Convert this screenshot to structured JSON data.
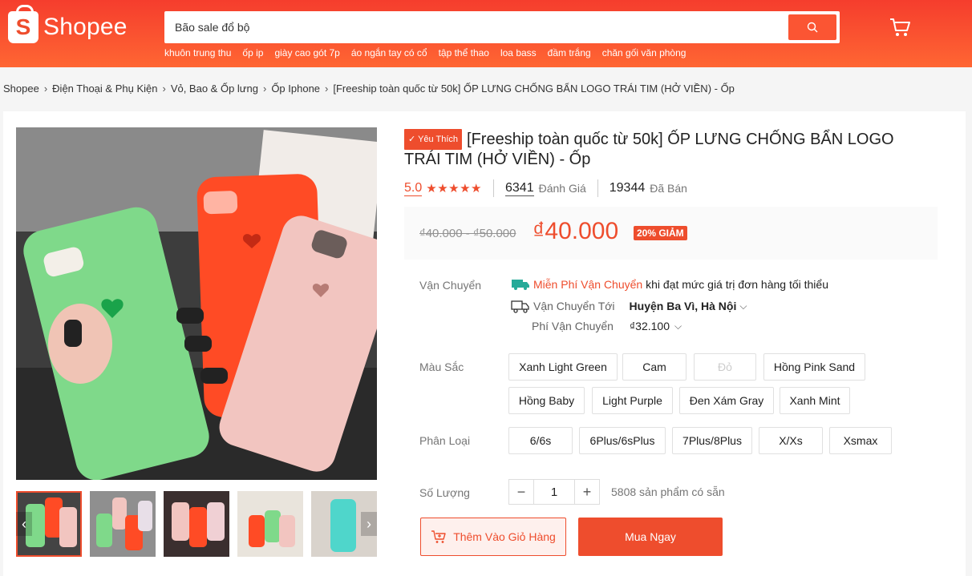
{
  "header": {
    "logo_text": "Shopee",
    "logo_glyph": "S",
    "search_placeholder": "Bão sale đổ bộ",
    "suggestions": [
      "khuôn trung thu",
      "ốp ip",
      "giày cao gót 7p",
      "áo ngắn tay có cổ",
      "tập thể thao",
      "loa bass",
      "đầm trắng",
      "chăn gối văn phòng"
    ],
    "icons": {
      "search": "search-icon",
      "cart": "cart-icon"
    }
  },
  "breadcrumb": [
    "Shopee",
    "Điện Thoại & Phụ Kiện",
    "Vỏ, Bao & Ốp lưng",
    "Ốp Iphone",
    "[Freeship toàn quốc từ 50k] ỐP LƯNG CHỐNG BẨN LOGO TRÁI TIM (HỞ VIỀN) - Ốp"
  ],
  "product": {
    "badge": "Yêu Thích",
    "title": "[Freeship toàn quốc từ 50k] ỐP LƯNG CHỐNG BẨN LOGO TRÁI TIM (HỞ VIỀN) - Ốp",
    "rating": "5.0",
    "rating_stars": 5,
    "reviews_count": "6341",
    "reviews_label": "Đánh Giá",
    "sold_count": "19344",
    "sold_label": "Đã Bán",
    "old_price": "₫40.000 - ₫50.000",
    "price": "₫40.000",
    "discount": "20% GIẢM"
  },
  "shipping": {
    "label": "Vận Chuyển",
    "free_text": "Miễn Phí Vận Chuyển",
    "free_suffix": "khi đạt mức giá trị đơn hàng tối thiểu",
    "to_label": "Vận Chuyển Tới",
    "to_value": "Huyện Ba Vì, Hà Nội",
    "fee_label": "Phí Vận Chuyển",
    "fee_value": "₫32.100"
  },
  "colors": {
    "label": "Màu Sắc",
    "options": [
      {
        "name": "Xanh Light Green",
        "available": true
      },
      {
        "name": "Cam",
        "available": true
      },
      {
        "name": "Đỏ",
        "available": false
      },
      {
        "name": "Hồng Pink Sand",
        "available": true
      },
      {
        "name": "Hồng Baby",
        "available": true
      },
      {
        "name": "Light Purple",
        "available": true
      },
      {
        "name": "Đen Xám Gray",
        "available": true
      },
      {
        "name": "Xanh Mint",
        "available": true
      }
    ]
  },
  "variants": {
    "label": "Phân Loại",
    "options": [
      "6/6s",
      "6Plus/6sPlus",
      "7Plus/8Plus",
      "X/Xs",
      "Xsmax"
    ]
  },
  "quantity": {
    "label": "Số Lượng",
    "value": "1",
    "minus": "−",
    "plus": "+",
    "stock": "5808 sản phẩm có sẵn"
  },
  "actions": {
    "add_to_cart": "Thêm Vào Giỏ Hàng",
    "buy_now": "Mua Ngay"
  },
  "theme": {
    "brand": "#ee4d2d",
    "header_gradient": [
      "#f53d2d",
      "#ff6633"
    ]
  }
}
